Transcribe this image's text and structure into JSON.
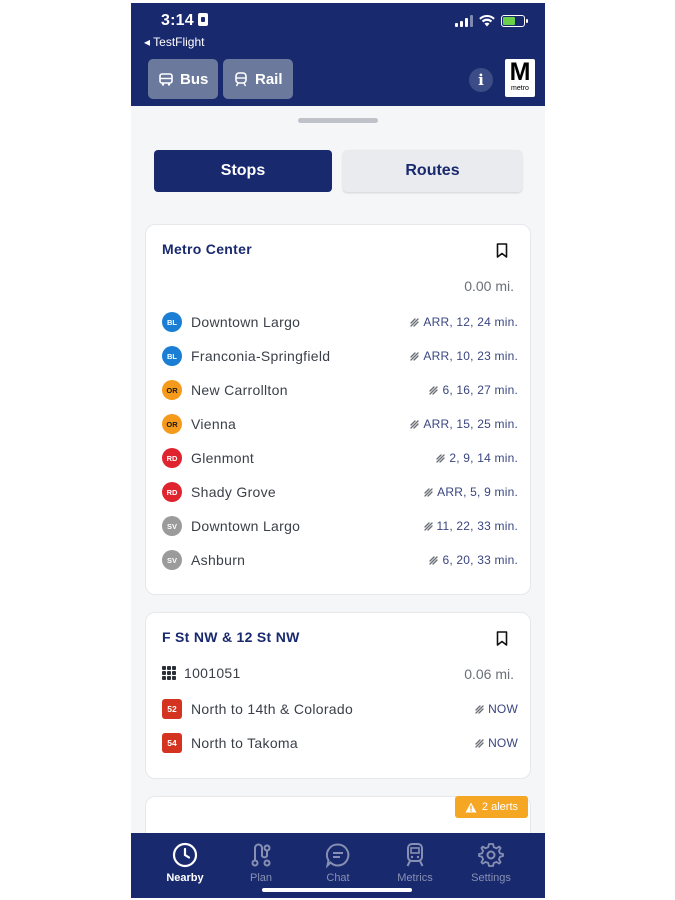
{
  "status_bar": {
    "time": "3:14",
    "back_app": "◂ TestFlight"
  },
  "header": {
    "bus_label": "Bus",
    "rail_label": "Rail",
    "info_label": "i",
    "logo_letter": "M",
    "logo_word": "metro"
  },
  "segments": {
    "stops_label": "Stops",
    "routes_label": "Routes"
  },
  "stations": [
    {
      "name": "Metro Center",
      "distance": "0.00 mi.",
      "arrivals": [
        {
          "line": "BL",
          "line_color": "#1a7fd4",
          "destination": "Downtown Largo",
          "times": "ARR, 12, 24 min."
        },
        {
          "line": "BL",
          "line_color": "#1a7fd4",
          "destination": "Franconia-Springfield",
          "times": "ARR, 10, 23 min."
        },
        {
          "line": "OR",
          "line_color": "#f59a1b",
          "destination": "New Carrollton",
          "times": "6, 16, 27 min."
        },
        {
          "line": "OR",
          "line_color": "#f59a1b",
          "destination": "Vienna",
          "times": "ARR, 15, 25 min."
        },
        {
          "line": "RD",
          "line_color": "#e0242f",
          "destination": "Glenmont",
          "times": "2, 9, 14 min."
        },
        {
          "line": "RD",
          "line_color": "#e0242f",
          "destination": "Shady Grove",
          "times": "ARR, 5, 9 min."
        },
        {
          "line": "SV",
          "line_color": "#9b9b9b",
          "destination": "Downtown Largo",
          "times": "11, 22, 33 min."
        },
        {
          "line": "SV",
          "line_color": "#9b9b9b",
          "destination": "Ashburn",
          "times": "6, 20, 33 min."
        }
      ]
    }
  ],
  "bus_stop": {
    "name": "F St NW & 12 St NW",
    "stop_id": "1001051",
    "distance": "0.06 mi.",
    "arrivals": [
      {
        "route": "52",
        "route_color": "#d4331f",
        "destination": "North to 14th & Colorado",
        "times": "NOW"
      },
      {
        "route": "54",
        "route_color": "#d4331f",
        "destination": "North to Takoma",
        "times": "NOW"
      }
    ]
  },
  "next_card": {
    "alerts_label": "2 alerts",
    "alert_color": "#f5a623"
  },
  "tabbar": {
    "tabs": [
      {
        "label": "Nearby",
        "icon": "clock-icon",
        "active": true
      },
      {
        "label": "Plan",
        "icon": "route-icon",
        "active": false
      },
      {
        "label": "Chat",
        "icon": "chat-icon",
        "active": false
      },
      {
        "label": "Metrics",
        "icon": "train-icon",
        "active": false
      },
      {
        "label": "Settings",
        "icon": "gear-icon",
        "active": false
      }
    ]
  },
  "colors": {
    "brand_navy": "#19296e",
    "background": "#f4f6f8",
    "card": "#ffffff"
  }
}
